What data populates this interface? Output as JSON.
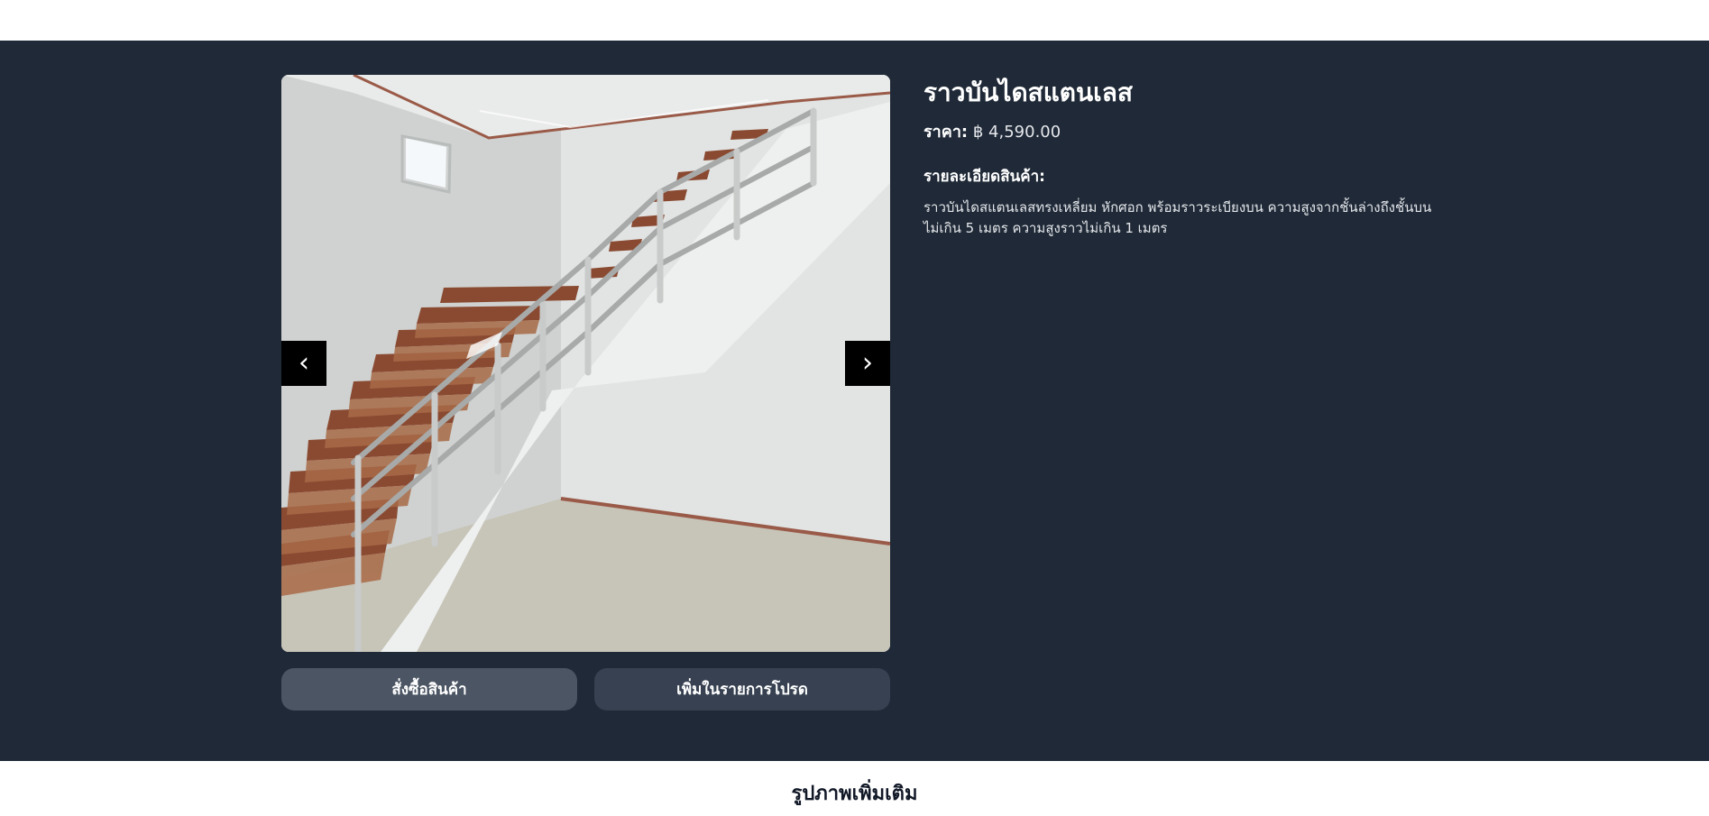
{
  "product": {
    "title": "ราวบันไดสแตนเลส",
    "price_label": "ราคา:",
    "price_value": "฿ 4,590.00",
    "description_heading": "รายละเอียดสินค้า:",
    "description": "ราวบันไดสแตนเลสทรงเหลี่ยม หักศอก พร้อมราวระเบียงบน ความสูงจากชั้นล่างถึงชั้นบน ไม่เกิน 5 เมตร ความสูงราวไม่เกิน 1 เมตร"
  },
  "gallery": {
    "prev_label": "‹",
    "next_label": "›",
    "image_icon": "stairs-photo"
  },
  "actions": {
    "order_label": "สั่งซื้อสินค้า",
    "favorite_label": "เพิ่มในรายการโปรด"
  },
  "more_images": {
    "title": "รูปภาพเพิ่มเติม"
  },
  "colors": {
    "section_bg": "#1f2937",
    "order_button": "#4b5563",
    "favorite_button": "#374151"
  }
}
